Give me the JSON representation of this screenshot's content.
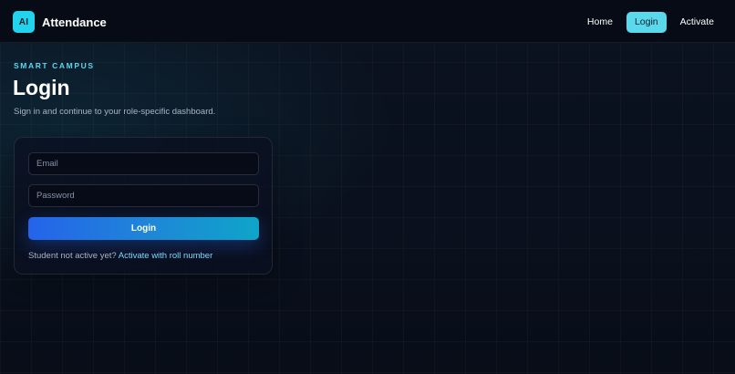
{
  "header": {
    "logo_text": "AI",
    "app_name": "Attendance",
    "nav": [
      {
        "label": "Home"
      },
      {
        "label": "Login"
      },
      {
        "label": "Activate"
      }
    ]
  },
  "hero": {
    "eyebrow": "SMART CAMPUS",
    "title": "Login",
    "subtitle": "Sign in and continue to your role-specific dashboard."
  },
  "form": {
    "email_placeholder": "Email",
    "email_value": "",
    "password_placeholder": "Password",
    "password_value": "",
    "submit_label": "Login",
    "helper_text": "Student not active yet?",
    "activate_link": "Activate with roll number"
  },
  "theme": {
    "accent": "#22d3ee",
    "button_gradient_start": "#2563eb",
    "button_gradient_end": "#0ea5c9",
    "background": "#0b1220"
  }
}
